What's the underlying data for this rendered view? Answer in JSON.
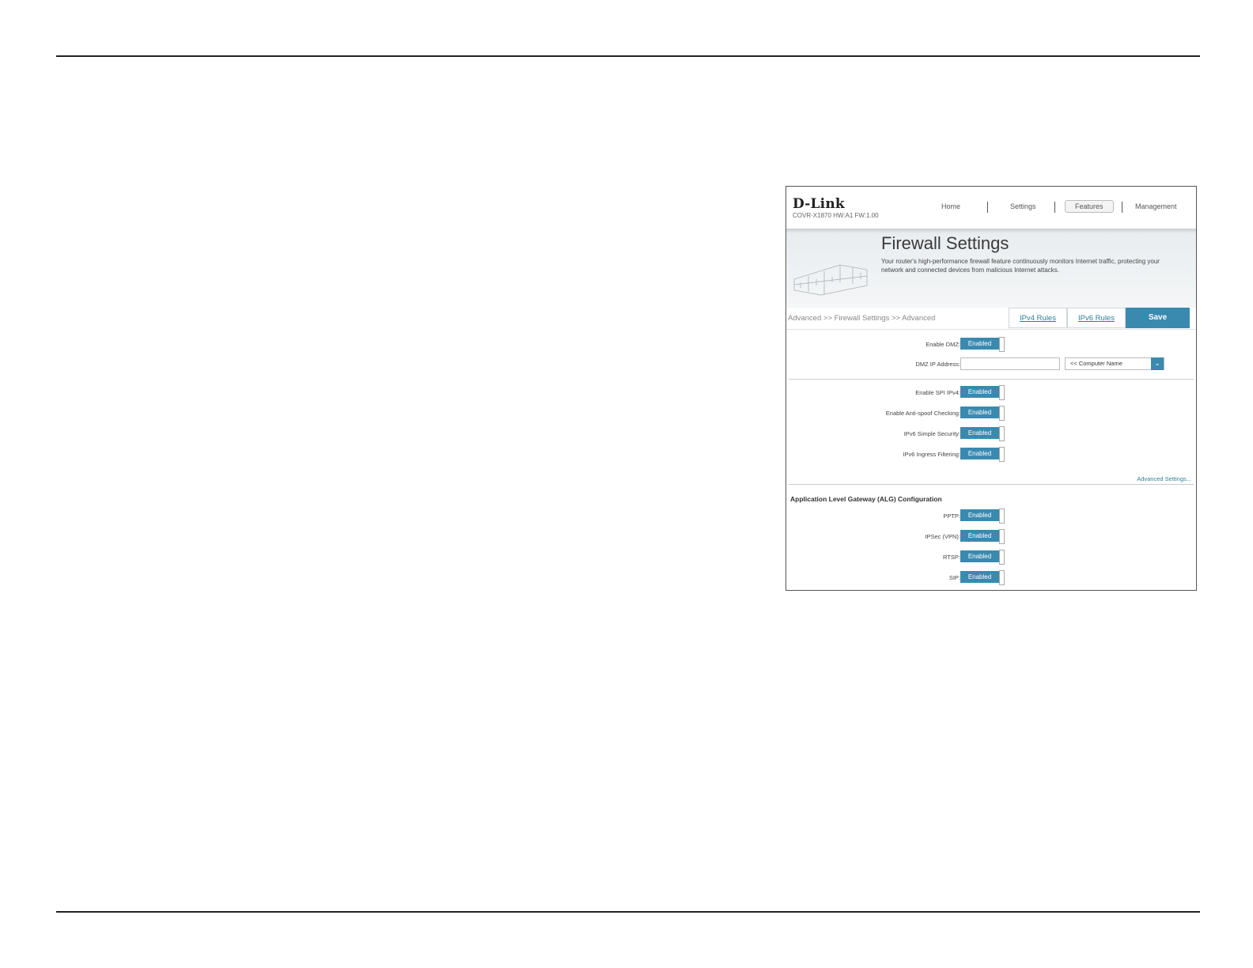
{
  "header": {
    "logo_text": "D-Link",
    "model_line": "COVR-X1870 HW:A1 FW:1.00",
    "nav": [
      "Home",
      "Settings",
      "Features",
      "Management"
    ],
    "selected_nav": "Features"
  },
  "banner": {
    "title": "Firewall Settings",
    "description": "Your router's high-performance firewall feature continuously monitors Internet traffic, protecting your network and connected devices from malicious Internet attacks."
  },
  "toolbar": {
    "breadcrumb": "Advanced >> Firewall Settings >> Advanced",
    "ipv4_rules": "IPv4 Rules",
    "ipv6_rules": "IPv6 Rules",
    "save": "Save"
  },
  "dmz": {
    "enable_label": "Enable DMZ:",
    "enable_state": "Enabled",
    "ip_label": "DMZ IP Address:",
    "ip_value": "",
    "computer_select": "<< Computer Name"
  },
  "security": [
    {
      "label": "Enable SPI IPv4:",
      "state": "Enabled"
    },
    {
      "label": "Enable Anti-spoof Checking:",
      "state": "Enabled"
    },
    {
      "label": "IPv6 Simple Security:",
      "state": "Enabled"
    },
    {
      "label": "IPv6 Ingress Filtering:",
      "state": "Enabled"
    }
  ],
  "advanced_link": "Advanced Settings...",
  "alg": {
    "title": "Application Level Gateway (ALG) Configuration",
    "items": [
      {
        "label": "PPTP:",
        "state": "Enabled"
      },
      {
        "label": "IPSec (VPN):",
        "state": "Enabled"
      },
      {
        "label": "RTSP:",
        "state": "Enabled"
      },
      {
        "label": "SIP:",
        "state": "Enabled"
      }
    ]
  },
  "colors": {
    "accent": "#3a8ab0",
    "link": "#2f7f99"
  }
}
